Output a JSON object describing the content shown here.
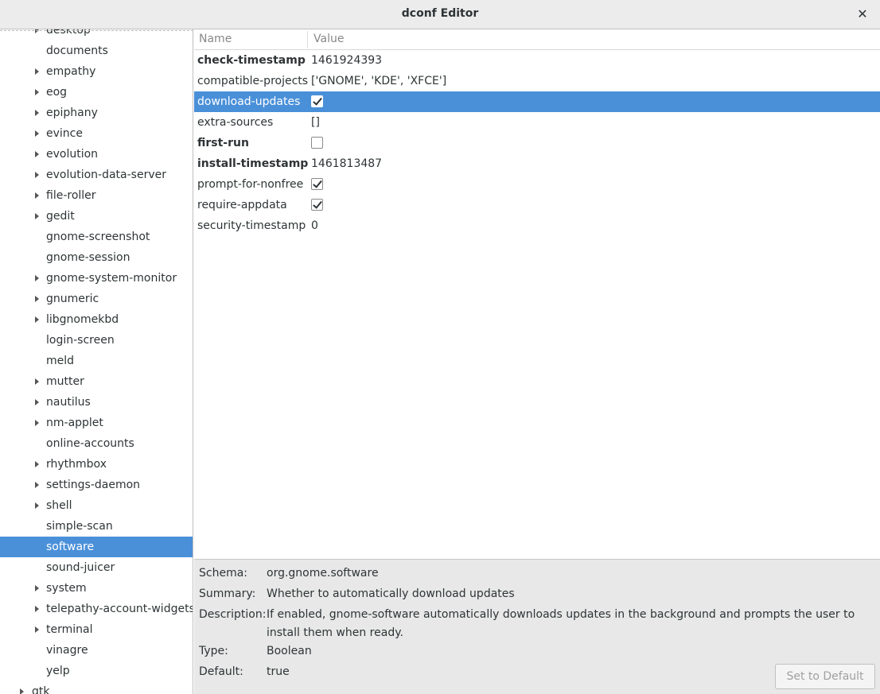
{
  "window": {
    "title": "dconf Editor",
    "close_glyph": "✕"
  },
  "sidebar": {
    "top_partial": "desktop",
    "items": [
      {
        "label": "documents",
        "expandable": false
      },
      {
        "label": "empathy",
        "expandable": true
      },
      {
        "label": "eog",
        "expandable": true
      },
      {
        "label": "epiphany",
        "expandable": true
      },
      {
        "label": "evince",
        "expandable": true
      },
      {
        "label": "evolution",
        "expandable": true
      },
      {
        "label": "evolution-data-server",
        "expandable": true
      },
      {
        "label": "file-roller",
        "expandable": true
      },
      {
        "label": "gedit",
        "expandable": true
      },
      {
        "label": "gnome-screenshot",
        "expandable": false
      },
      {
        "label": "gnome-session",
        "expandable": false
      },
      {
        "label": "gnome-system-monitor",
        "expandable": true
      },
      {
        "label": "gnumeric",
        "expandable": true
      },
      {
        "label": "libgnomekbd",
        "expandable": true
      },
      {
        "label": "login-screen",
        "expandable": false
      },
      {
        "label": "meld",
        "expandable": false
      },
      {
        "label": "mutter",
        "expandable": true
      },
      {
        "label": "nautilus",
        "expandable": true
      },
      {
        "label": "nm-applet",
        "expandable": true
      },
      {
        "label": "online-accounts",
        "expandable": false
      },
      {
        "label": "rhythmbox",
        "expandable": true
      },
      {
        "label": "settings-daemon",
        "expandable": true
      },
      {
        "label": "shell",
        "expandable": true
      },
      {
        "label": "simple-scan",
        "expandable": false
      },
      {
        "label": "software",
        "expandable": false,
        "selected": true
      },
      {
        "label": "sound-juicer",
        "expandable": false
      },
      {
        "label": "system",
        "expandable": true
      },
      {
        "label": "telepathy-account-widgets",
        "expandable": true
      },
      {
        "label": "terminal",
        "expandable": true
      },
      {
        "label": "vinagre",
        "expandable": false
      },
      {
        "label": "yelp",
        "expandable": false
      }
    ],
    "bottom_partial": "gtk"
  },
  "keys": {
    "columns": {
      "name": "Name",
      "value": "Value"
    },
    "rows": [
      {
        "name": "check-timestamp",
        "value": "1461924393",
        "bold": true
      },
      {
        "name": "compatible-projects",
        "value": "['GNOME', 'KDE', 'XFCE']",
        "bold": false
      },
      {
        "name": "download-updates",
        "checkbox": true,
        "checked": true,
        "bold": false,
        "selected": true
      },
      {
        "name": "extra-sources",
        "value": "[]",
        "bold": false
      },
      {
        "name": "first-run",
        "checkbox": true,
        "checked": false,
        "bold": true
      },
      {
        "name": "install-timestamp",
        "value": "1461813487",
        "bold": true
      },
      {
        "name": "prompt-for-nonfree",
        "checkbox": true,
        "checked": true,
        "bold": false
      },
      {
        "name": "require-appdata",
        "checkbox": true,
        "checked": true,
        "bold": false
      },
      {
        "name": "security-timestamp",
        "value": "0",
        "bold": false
      }
    ]
  },
  "info": {
    "schema_label": "Schema:",
    "schema": "org.gnome.software",
    "summary_label": "Summary:",
    "summary": "Whether to automatically download updates",
    "description_label": "Description:",
    "description": "If enabled, gnome-software automatically downloads updates in the background and prompts the user to install them when ready.",
    "type_label": "Type:",
    "type": "Boolean",
    "default_label": "Default:",
    "default": "true",
    "set_default_label": "Set to Default"
  }
}
